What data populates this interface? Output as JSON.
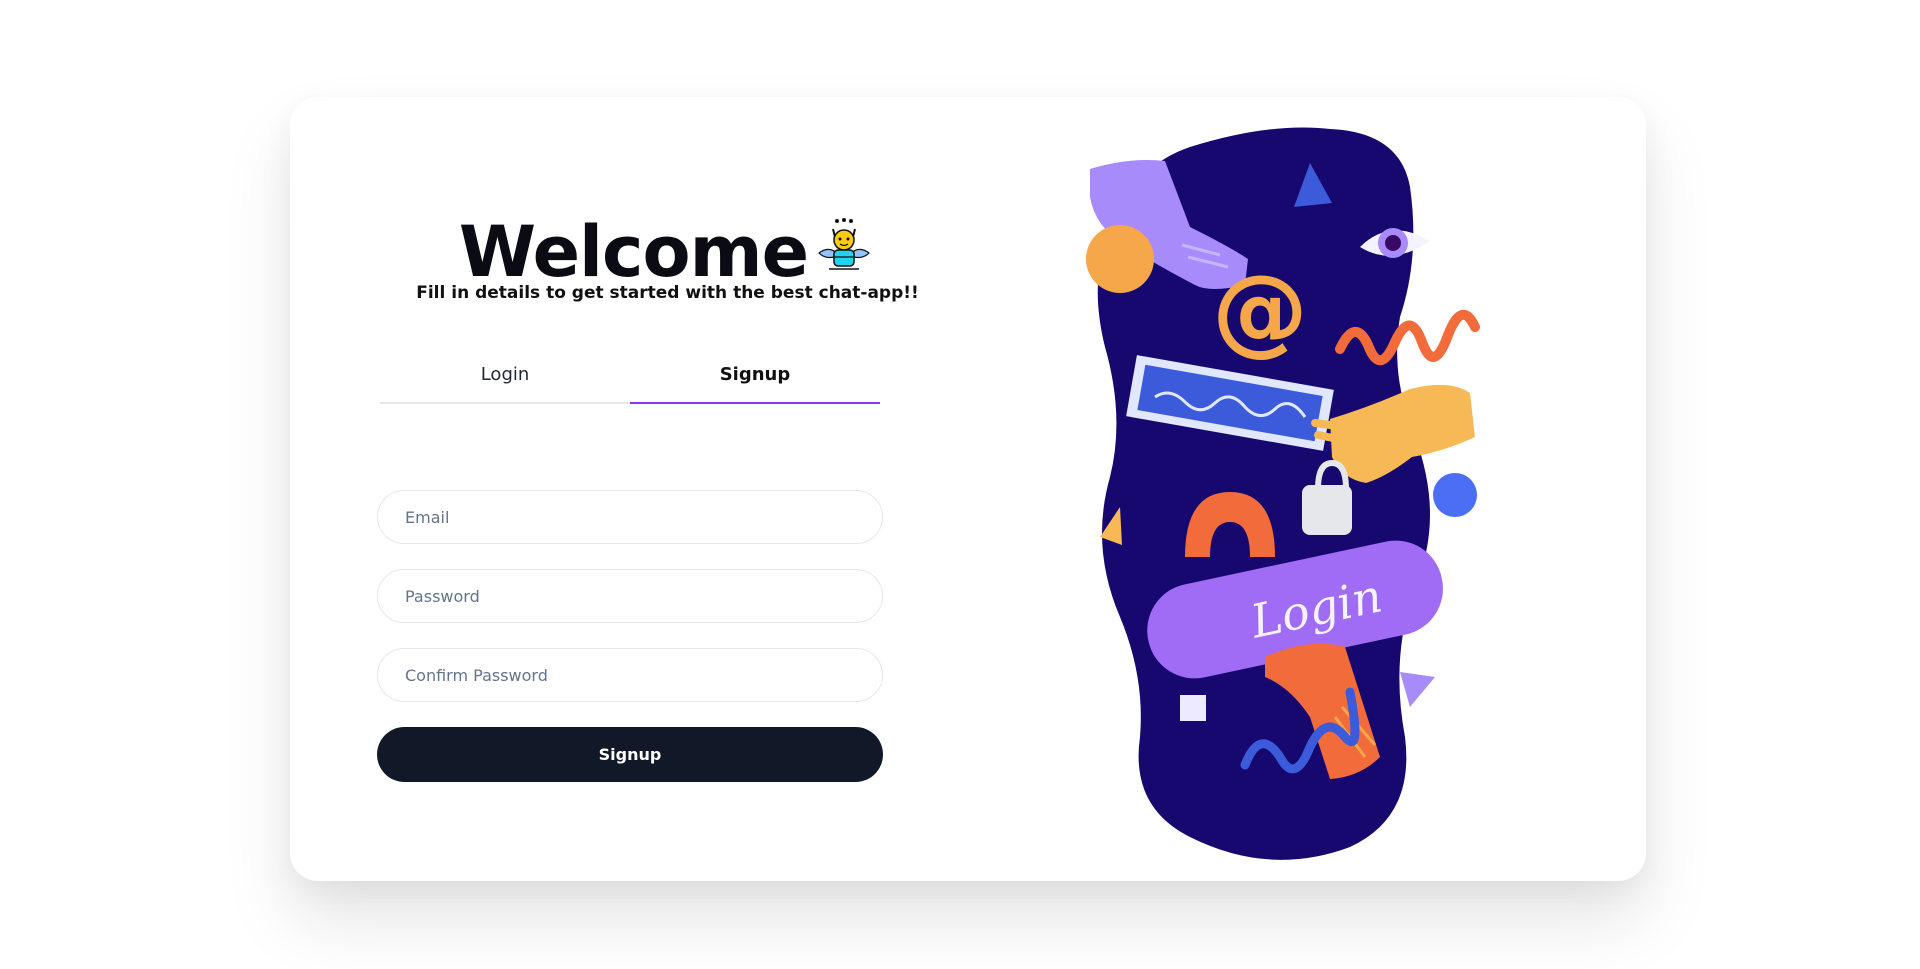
{
  "welcome": {
    "title": "Welcome",
    "subtitle": "Fill in details to get started with the best chat-app!!"
  },
  "tabs": [
    {
      "label": "Login",
      "active": false
    },
    {
      "label": "Signup",
      "active": true
    }
  ],
  "form": {
    "email_placeholder": "Email",
    "password_placeholder": "Password",
    "confirm_password_placeholder": "Confirm Password",
    "submit_label": "Signup"
  },
  "illustration": {
    "button_text": "Login"
  },
  "colors": {
    "accent": "#9333ea",
    "button": "#111827",
    "illustration_bg": "#16086f"
  }
}
